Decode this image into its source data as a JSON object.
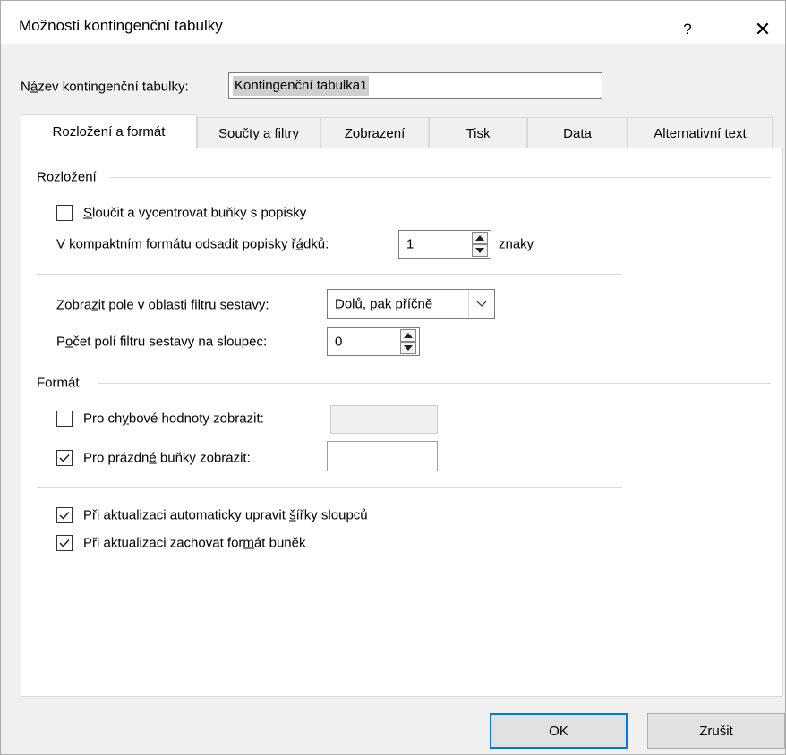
{
  "dialog": {
    "title": "Možnosti kontingenční tabulky",
    "help": "?",
    "close": "✕"
  },
  "name_field": {
    "label_pre": "N",
    "label_u": "á",
    "label_post": "zev kontingenční tabulky:",
    "value": "Kontingenční tabulka1"
  },
  "tabs": [
    {
      "label": "Rozložení a formát",
      "active": true
    },
    {
      "label": "Součty a filtry",
      "active": false
    },
    {
      "label": "Zobrazení",
      "active": false
    },
    {
      "label": "Tisk",
      "active": false
    },
    {
      "label": "Data",
      "active": false
    },
    {
      "label": "Alternativní text",
      "active": false
    }
  ],
  "layout": {
    "group_title": "Rozložení",
    "merge": {
      "u": "S",
      "rest": "loučit a vycentrovat buňky s popisky",
      "checked": false
    },
    "indent": {
      "pre": "V kompaktním formátu odsadit popisky ř",
      "u": "á",
      "post": "dků:",
      "value": "1",
      "suffix": "znaky"
    },
    "filter_area": {
      "pre": "Zobra",
      "u": "z",
      "post": "it pole v oblasti filtru sestavy:",
      "value": "Dolů, pak příčně"
    },
    "filter_count": {
      "pre": "P",
      "u": "o",
      "post": "čet polí filtru sestavy na sloupec:",
      "value": "0"
    }
  },
  "format": {
    "group_title": "Formát",
    "error_values": {
      "pre": "Pro ch",
      "u": "y",
      "post": "bové hodnoty zobrazit:",
      "checked": false,
      "value": ""
    },
    "empty_cells": {
      "pre": "Pro prázdn",
      "u": "é",
      "post": " buňky zobrazit:",
      "checked": true,
      "value": ""
    },
    "autofit": {
      "pre": "Při aktualizaci automaticky upravit ",
      "u": "š",
      "post": "ířky sloupců",
      "checked": true
    },
    "preserve": {
      "pre": "Při aktualizaci zachovat for",
      "u": "m",
      "post": "át buněk",
      "checked": true
    }
  },
  "buttons": {
    "ok": "OK",
    "cancel": "Zrušit"
  }
}
